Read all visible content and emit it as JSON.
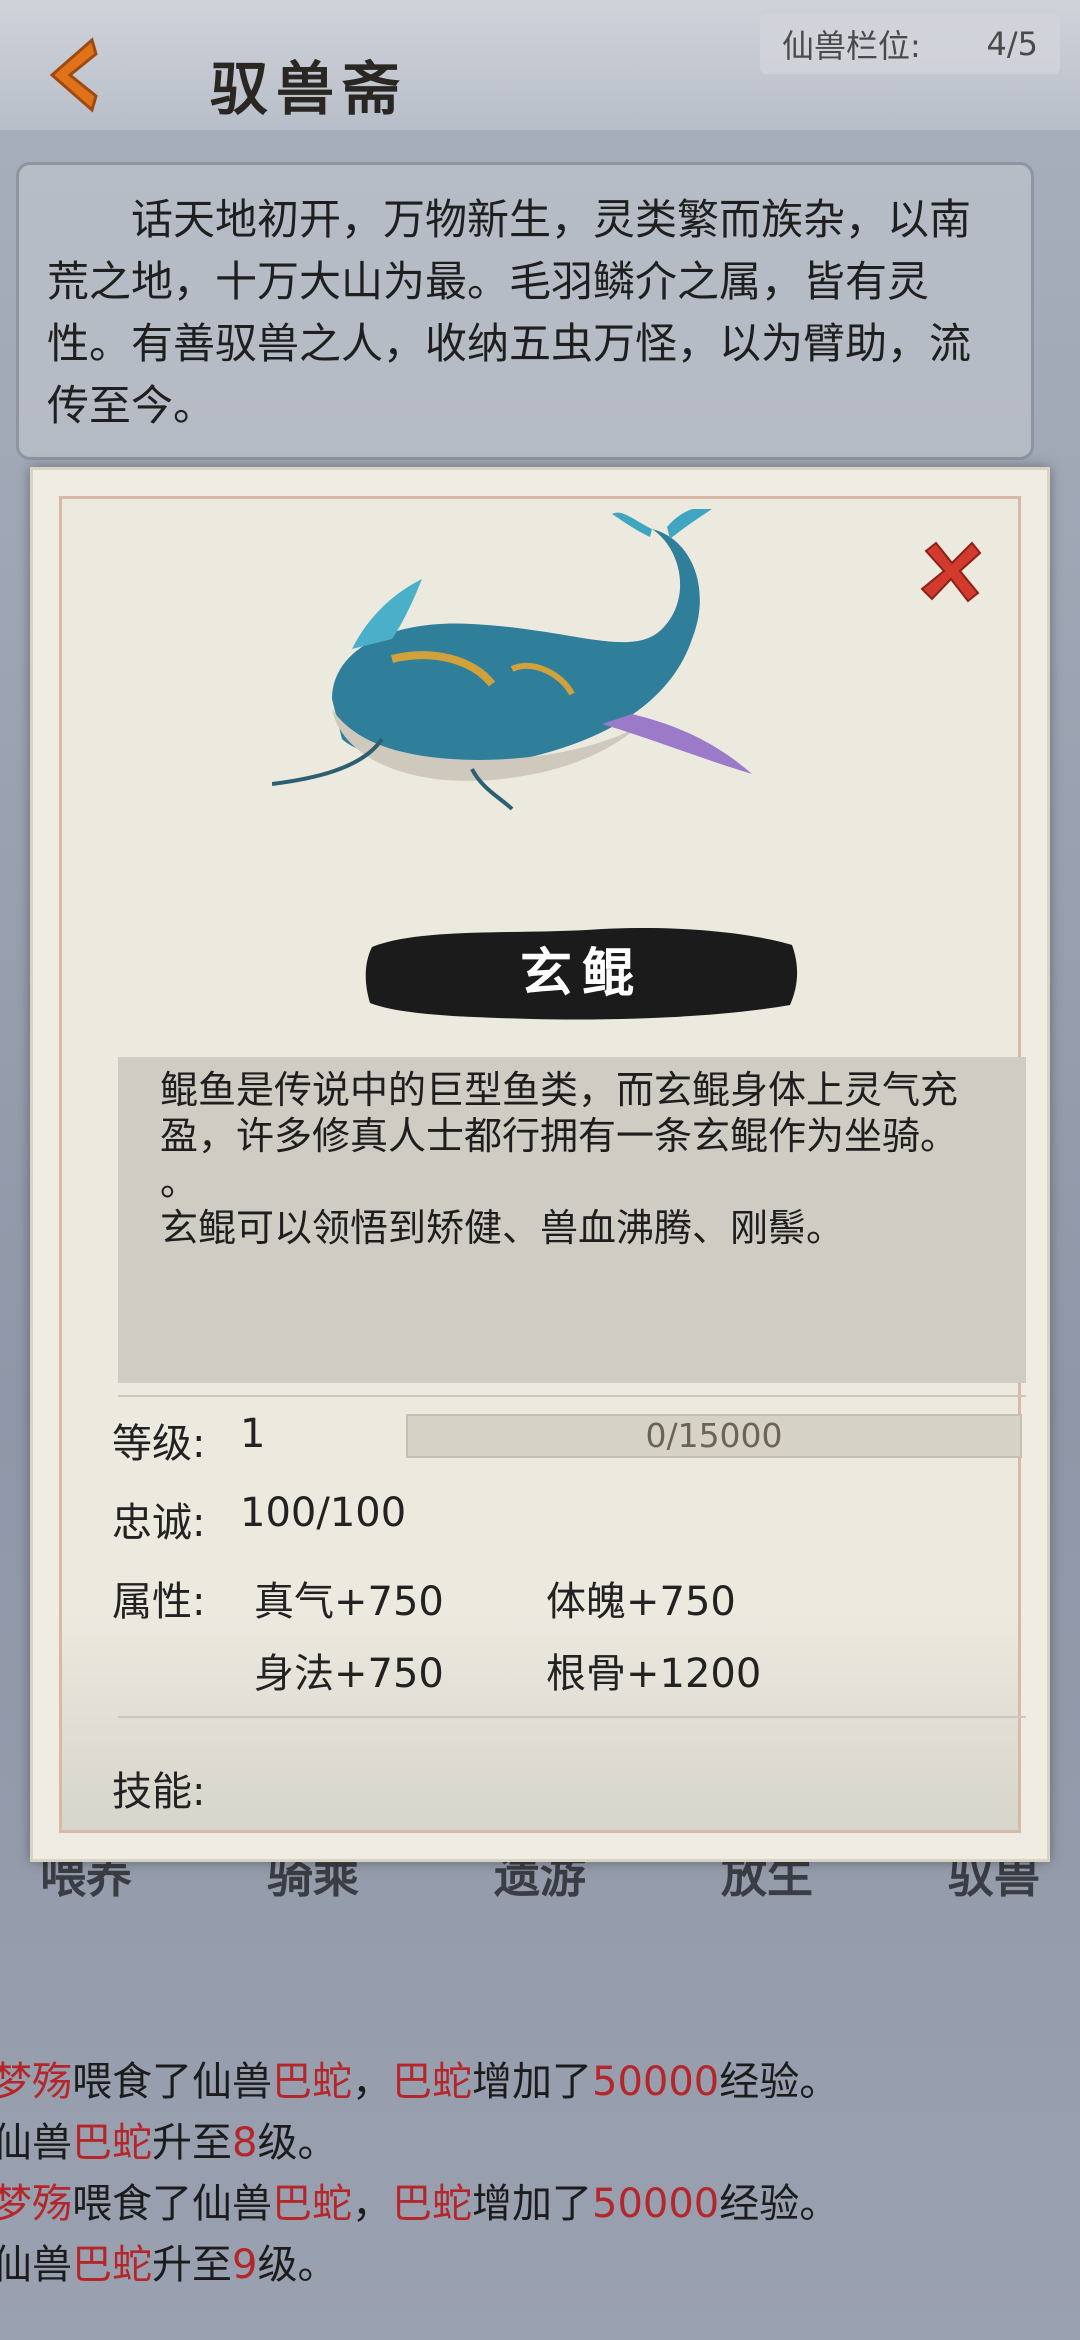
{
  "header": {
    "title": "驭兽斋",
    "slot_label": "仙兽栏位:",
    "slot_value": "4/5"
  },
  "intro": {
    "text": "话天地初开，万物新生，灵类繁而族杂，以南荒之地，十万大山为最。毛羽鳞介之属，皆有灵性。有善驭兽之人，收纳五虫万怪，以为臂助，流传至今。"
  },
  "tabs": [
    "喂养",
    "骑乘",
    "遗游",
    "放生",
    "驭兽"
  ],
  "log": [
    {
      "parts": [
        {
          "t": "梦殇",
          "red": true
        },
        {
          "t": "喂食了仙兽",
          "red": false
        },
        {
          "t": "巴蛇",
          "red": true
        },
        {
          "t": "，",
          "red": false
        },
        {
          "t": "巴蛇",
          "red": true
        },
        {
          "t": "增加了",
          "red": false
        },
        {
          "t": "50000",
          "red": true
        },
        {
          "t": "经验。",
          "red": false
        }
      ]
    },
    {
      "parts": [
        {
          "t": "仙兽",
          "red": false
        },
        {
          "t": "巴蛇",
          "red": true
        },
        {
          "t": "升至",
          "red": false
        },
        {
          "t": "8",
          "red": true
        },
        {
          "t": "级。",
          "red": false
        }
      ]
    },
    {
      "parts": [
        {
          "t": "梦殇",
          "red": true
        },
        {
          "t": "喂食了仙兽",
          "red": false
        },
        {
          "t": "巴蛇",
          "red": true
        },
        {
          "t": "，",
          "red": false
        },
        {
          "t": "巴蛇",
          "red": true
        },
        {
          "t": "增加了",
          "red": false
        },
        {
          "t": "50000",
          "red": true
        },
        {
          "t": "经验。",
          "red": false
        }
      ]
    },
    {
      "parts": [
        {
          "t": "仙兽",
          "red": false
        },
        {
          "t": "巴蛇",
          "red": true
        },
        {
          "t": "升至",
          "red": false
        },
        {
          "t": "9",
          "red": true
        },
        {
          "t": "级。",
          "red": false
        }
      ]
    }
  ],
  "popup": {
    "pet_name": "玄鲲",
    "description": [
      "鲲鱼是传说中的巨型鱼类，而玄鲲身体上灵气充",
      "盈，许多修真人士都行拥有一条玄鲲作为坐骑。",
      "。",
      "玄鲲可以领悟到矫健、兽血沸腾、刚鬃。"
    ],
    "level_label": "等级:",
    "level_value": "1",
    "exp_text": "0/15000",
    "exp_progress": 0,
    "loyalty_label": "忠诚:",
    "loyalty_value": "100/100",
    "attr_label": "属性:",
    "attributes": [
      "真气+750",
      "体魄+750",
      "身法+750",
      "根骨+1200"
    ],
    "skill_label": "技能:"
  },
  "colors": {
    "accent_red": "#b5262a",
    "back_arrow": "#e0731a",
    "close_x": "#d23a2e"
  }
}
